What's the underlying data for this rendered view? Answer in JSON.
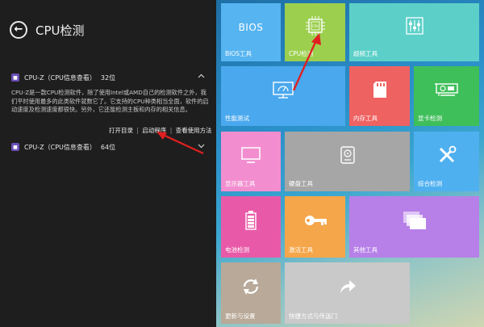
{
  "left_panel": {
    "title": "CPU检测",
    "back_glyph": "←",
    "item1": {
      "name": "CPU-Z（CPU信息查看）",
      "bits": "32位",
      "description": "CPU-Z是一款CPU检测软件，除了使用Intel或AMD自己的检测软件之外，我们平时使用最多的此类软件就数它了。它支持的CPU种类相当全面，软件的启动速度及检测速度都很快。另外，它还能检测主板和内存的相关信息。",
      "open_dir": "打开目录",
      "launch": "启动程序",
      "howto": "查看使用方法",
      "separator": "|"
    },
    "item2": {
      "name": "CPU-Z（CPU信息查看）",
      "bits": "64位"
    }
  },
  "tiles": {
    "bios": {
      "label": "BIOS工具",
      "icon_text": "BIOS",
      "color": "#56b4f0"
    },
    "cpu": {
      "label": "CPU检测",
      "icon_text": "CPU",
      "color": "#9ccf4e"
    },
    "overclock": {
      "label": "超频工具",
      "color": "#5cd0c8"
    },
    "performance": {
      "label": "性能测试",
      "color": "#4aa8ee"
    },
    "memory": {
      "label": "内存工具",
      "color": "#ef6262"
    },
    "gpu": {
      "label": "显卡检测",
      "color": "#3fbf5a"
    },
    "monitor": {
      "label": "显示器工具",
      "color": "#f28ecf"
    },
    "disk": {
      "label": "硬盘工具",
      "color": "#a6a6a6"
    },
    "diagnose": {
      "label": "综合检测",
      "color": "#4fb0f0"
    },
    "battery": {
      "label": "电池检测",
      "color": "#e85aa8"
    },
    "activation": {
      "label": "激活工具",
      "color": "#f5a64a"
    },
    "other": {
      "label": "其他工具",
      "color": "#b780e8"
    },
    "update": {
      "label": "更新与设置",
      "color": "#b8a998"
    },
    "shortcut": {
      "label": "快捷方式与传送门",
      "color": "#c9c9c9"
    }
  },
  "annotation_color": "#e02020"
}
